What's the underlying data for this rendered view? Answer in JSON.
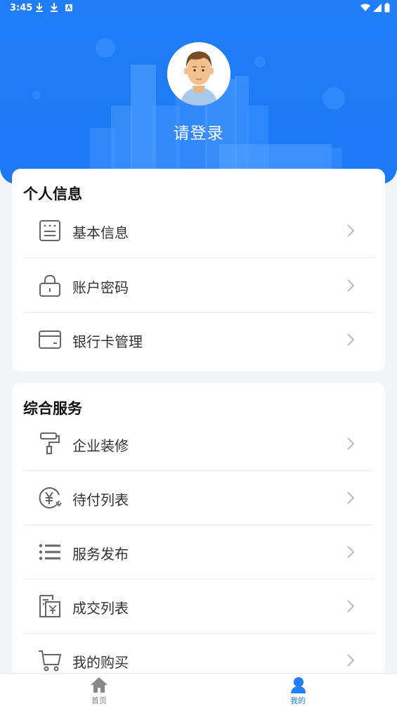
{
  "status_bar": {
    "time": "3:45"
  },
  "header": {
    "login_text": "请登录"
  },
  "personal": {
    "title": "个人信息",
    "items": [
      {
        "label": "基本信息",
        "icon": "id-card-icon"
      },
      {
        "label": "账户密码",
        "icon": "lock-icon"
      },
      {
        "label": "银行卡管理",
        "icon": "bank-card-icon"
      }
    ]
  },
  "services": {
    "title": "综合服务",
    "items": [
      {
        "label": "企业装修",
        "icon": "paint-roller-icon"
      },
      {
        "label": "待付列表",
        "icon": "yen-circle-icon"
      },
      {
        "label": "服务发布",
        "icon": "list-icon"
      },
      {
        "label": "成交列表",
        "icon": "yen-document-icon"
      },
      {
        "label": "我的购买",
        "icon": "cart-icon"
      }
    ]
  },
  "tabbar": {
    "home": "首页",
    "mine": "我的"
  },
  "colors": {
    "primary": "#1f7ef8",
    "icon": "#666666",
    "chevron": "#bbbbbb"
  }
}
